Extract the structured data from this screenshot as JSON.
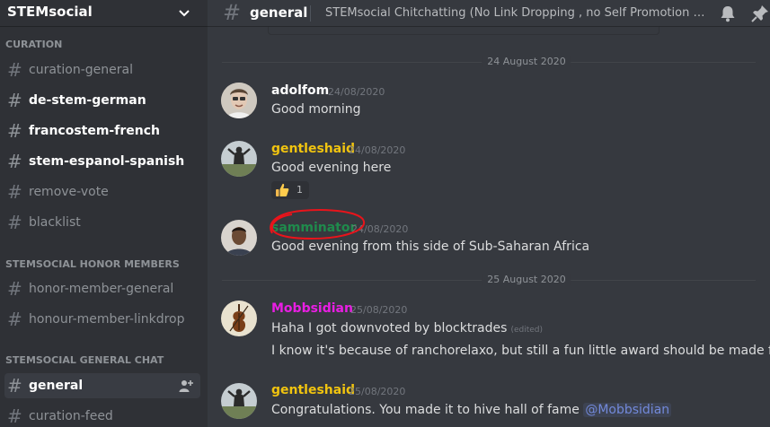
{
  "server": {
    "name": "STEMsocial"
  },
  "sidebar": {
    "categories": [
      {
        "label": "CURATION",
        "channels": [
          {
            "name": "curation-general",
            "state": "muted"
          },
          {
            "name": "de-stem-german",
            "state": "unread"
          },
          {
            "name": "francostem-french",
            "state": "unread"
          },
          {
            "name": "stem-espanol-spanish",
            "state": "unread"
          },
          {
            "name": "remove-vote",
            "state": "muted"
          },
          {
            "name": "blacklist",
            "state": "muted"
          }
        ]
      },
      {
        "label": "STEMSOCIAL HONOR MEMBERS",
        "channels": [
          {
            "name": "honor-member-general",
            "state": "muted"
          },
          {
            "name": "honour-member-linkdrop",
            "state": "muted"
          }
        ]
      },
      {
        "label": "STEMSOCIAL GENERAL CHAT",
        "channels": [
          {
            "name": "general",
            "state": "active"
          },
          {
            "name": "curation-feed",
            "state": "muted"
          }
        ]
      }
    ]
  },
  "topbar": {
    "channel": "general",
    "topic": "STEMsocial Chitchatting (No Link Dropping , no Self Promotion Here, and please be respectful)"
  },
  "dividers": [
    "24 August 2020",
    "25 August 2020"
  ],
  "messages": [
    {
      "author": "adolfom",
      "author_color": "#ffffff",
      "time": "24/08/2020",
      "lines": [
        "Good morning"
      ]
    },
    {
      "author": "gentleshaid",
      "author_color": "#f1c40f",
      "time": "24/08/2020",
      "lines": [
        "Good evening here"
      ],
      "reaction": {
        "emoji": "thumbs-up-icon",
        "count": "1"
      }
    },
    {
      "author": "samminator",
      "author_color": "#1f8b4c",
      "time": "24/08/2020",
      "lines": [
        "Good evening from this side of Sub-Saharan Africa"
      ]
    },
    {
      "author": "Mobbsidian",
      "author_color": "#e91ee3",
      "time": "25/08/2020",
      "lines": [
        "Haha I got downvoted by blocktrades",
        "I know it's because of ranchorelaxo, but still a fun little award should be made for it"
      ],
      "edited": "(edited)"
    },
    {
      "author": "gentleshaid",
      "author_color": "#f1c40f",
      "time": "25/08/2020",
      "lines": [
        "Congratulations. You made it to hive hall of fame"
      ],
      "mention": "@Mobbsidian"
    }
  ],
  "colors": {
    "annotation": "#e8141b",
    "accent": "#7289da"
  }
}
